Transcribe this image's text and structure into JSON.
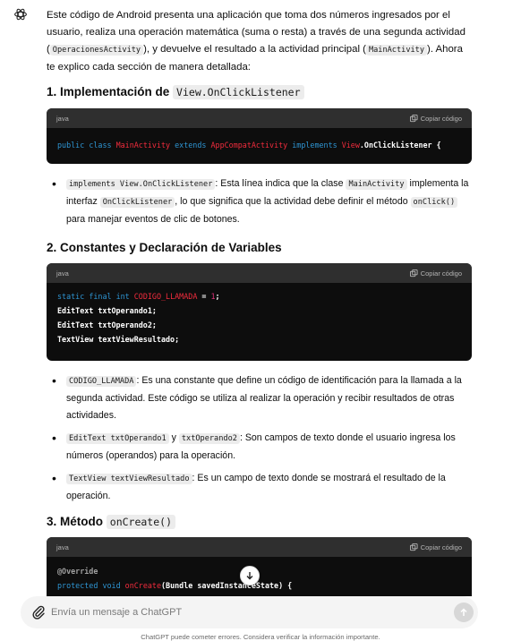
{
  "intro": {
    "t1": "Este código de Android presenta una aplicación que toma dos números ingresados por el usuario, realiza una operación matemática (suma o resta) a través de una segunda actividad (",
    "c1": "OperacionesActivity",
    "t2": "), y devuelve el resultado a la actividad principal (",
    "c2": "MainActivity",
    "t3": "). Ahora te explico cada sección de manera detallada:"
  },
  "sections": [
    {
      "title_prefix": "1. ",
      "title_text": "Implementación de ",
      "title_code": "View.OnClickListener"
    },
    {
      "title_prefix": "2. ",
      "title_text": "Constantes y Declaración de Variables"
    },
    {
      "title_prefix": "3. ",
      "title_text": "Método ",
      "title_code": "onCreate()"
    }
  ],
  "code_blocks": [
    {
      "lang": "java",
      "copy_label": "Copiar código"
    },
    {
      "lang": "java",
      "copy_label": "Copiar código"
    },
    {
      "lang": "java",
      "copy_label": "Copiar código"
    }
  ],
  "code1": {
    "public": "public",
    "class": "class",
    "MainActivity": "MainActivity",
    "extends": "extends",
    "AppCompatActivity": "AppCompatActivity",
    "implements": "implements",
    "View": "View",
    "rest": ".OnClickListener {"
  },
  "code2": {
    "static": "static",
    "final": "final",
    "int": "int",
    "name": "CODIGO_LLAMADA",
    "eq": " = ",
    "num": "1",
    "semi": ";",
    "line2": "EditText txtOperando1;",
    "line3": "EditText txtOperando2;",
    "line4": "TextView textViewResultado;"
  },
  "code3": {
    "override": "@Override",
    "protected": "protected",
    "void": "void",
    "onCreate": "onCreate",
    "rest": "(Bundle savedInstanceState) {"
  },
  "bullets1": [
    {
      "code": "implements View.OnClickListener",
      "t1": ": Esta línea indica que la clase ",
      "c2": "MainActivity",
      "t2": " implementa la interfaz ",
      "c3": "OnClickListener",
      "t3": ", lo que significa que la actividad debe definir el método ",
      "c4": "onClick()",
      "t4": " para manejar eventos de clic de botones."
    }
  ],
  "bullets2": [
    {
      "code": "CODIGO_LLAMADA",
      "t1": ": Es una constante que define un código de identificación para la llamada a la segunda actividad. Este código se utiliza al realizar la operación y recibir resultados de otras actividades."
    },
    {
      "code": "EditText txtOperando1",
      "y": " y ",
      "c2": "txtOperando2",
      "t1": ": Son campos de texto donde el usuario ingresa los números (operandos) para la operación."
    },
    {
      "code": "TextView textViewResultado",
      "t1": ": Es un campo de texto donde se mostrará el resultado de la operación."
    }
  ],
  "composer": {
    "placeholder": "Envía un mensaje a ChatGPT"
  },
  "footer": "ChatGPT puede cometer errores. Considera verificar la información importante.",
  "colors": {
    "keyword": "#2e95d3",
    "type": "#f22c3d",
    "number": "#df3079",
    "code_bg": "#0d0d0d",
    "code_header": "#2f2f2f"
  },
  "icons": {
    "avatar": "openai-logo-icon",
    "copy": "copy-icon",
    "scroll": "arrow-down-icon",
    "attach": "paperclip-icon",
    "send": "arrow-up-icon"
  }
}
